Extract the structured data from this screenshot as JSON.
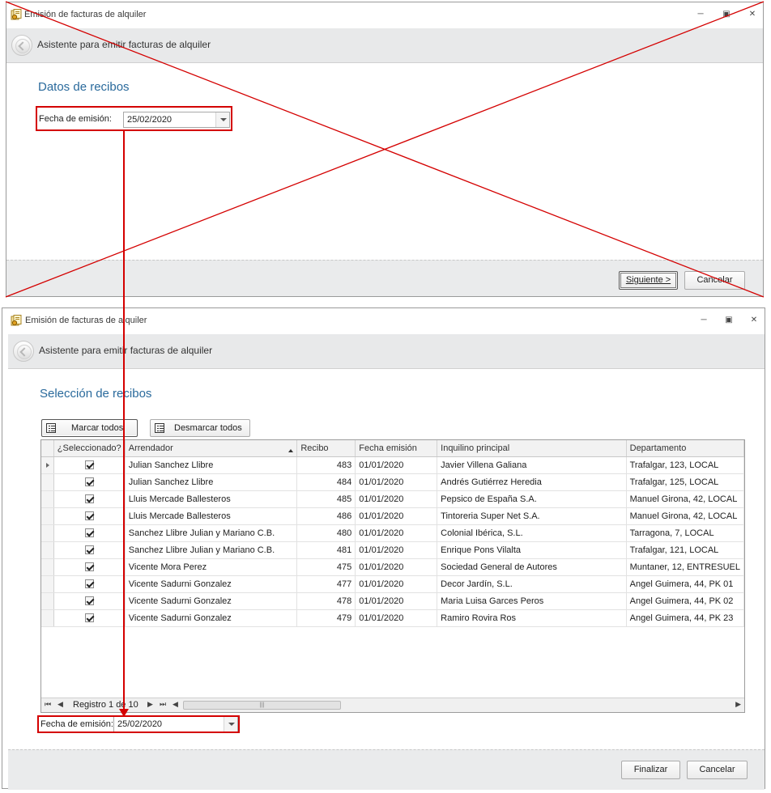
{
  "window_title": "Emisión de facturas de alquiler",
  "wizard_title": "Asistente para emitir facturas de alquiler",
  "step1": {
    "heading": "Datos de recibos",
    "date_label": "Fecha de emisión:",
    "date_value": "25/02/2020",
    "next_label_underlined": "S",
    "next_label_rest": "iguiente >",
    "cancel_label": "Cancelar"
  },
  "step2": {
    "heading": "Selección de recibos",
    "mark_all_label": "Marcar todos",
    "unmark_all_label": "Desmarcar todos",
    "columns": [
      "¿Seleccionado?",
      "Arrendador",
      "Recibo",
      "Fecha emisión",
      "Inquilino principal",
      "Departamento"
    ],
    "rows": [
      {
        "selected": true,
        "arrendador": "Julian Sanchez Llibre",
        "recibo": "483",
        "fecha": "01/01/2020",
        "inquilino": "Javier Villena Galiana",
        "departamento": "Trafalgar, 123, LOCAL"
      },
      {
        "selected": true,
        "arrendador": "Julian Sanchez Llibre",
        "recibo": "484",
        "fecha": "01/01/2020",
        "inquilino": "Andrés Gutiérrez Heredia",
        "departamento": "Trafalgar, 125, LOCAL"
      },
      {
        "selected": true,
        "arrendador": "Lluis Mercade Ballesteros",
        "recibo": "485",
        "fecha": "01/01/2020",
        "inquilino": "Pepsico de España S.A.",
        "departamento": "Manuel Girona, 42, LOCAL"
      },
      {
        "selected": true,
        "arrendador": "Lluis Mercade Ballesteros",
        "recibo": "486",
        "fecha": "01/01/2020",
        "inquilino": "Tintoreria Super Net S.A.",
        "departamento": "Manuel Girona, 42, LOCAL"
      },
      {
        "selected": true,
        "arrendador": "Sanchez Llibre Julian y Mariano C.B.",
        "recibo": "480",
        "fecha": "01/01/2020",
        "inquilino": "Colonial Ibérica, S.L.",
        "departamento": "Tarragona, 7, LOCAL"
      },
      {
        "selected": true,
        "arrendador": "Sanchez Llibre Julian y Mariano C.B.",
        "recibo": "481",
        "fecha": "01/01/2020",
        "inquilino": "Enrique Pons Vilalta",
        "departamento": "Trafalgar, 121, LOCAL"
      },
      {
        "selected": true,
        "arrendador": "Vicente Mora Perez",
        "recibo": "475",
        "fecha": "01/01/2020",
        "inquilino": "Sociedad General de Autores",
        "departamento": "Muntaner, 12, ENTRESUEL"
      },
      {
        "selected": true,
        "arrendador": "Vicente Sadurni Gonzalez",
        "recibo": "477",
        "fecha": "01/01/2020",
        "inquilino": "Decor Jardín, S.L.",
        "departamento": "Angel Guimera, 44, PK 01"
      },
      {
        "selected": true,
        "arrendador": "Vicente Sadurni Gonzalez",
        "recibo": "478",
        "fecha": "01/01/2020",
        "inquilino": "Maria Luisa Garces Peros",
        "departamento": "Angel Guimera, 44, PK 02"
      },
      {
        "selected": true,
        "arrendador": "Vicente Sadurni Gonzalez",
        "recibo": "479",
        "fecha": "01/01/2020",
        "inquilino": "Ramiro Rovira Ros",
        "departamento": "Angel Guimera, 44, PK 23"
      }
    ],
    "navigator_text": "Registro 1 de 10",
    "date_label": "Fecha de emisión:",
    "date_value": "25/02/2020",
    "finish_label": "Finalizar",
    "cancel_label": "Cancelar"
  },
  "colors": {
    "heading": "#2a6a9c",
    "annotation_red": "#d40000",
    "header_band": "#e8e9ea"
  }
}
